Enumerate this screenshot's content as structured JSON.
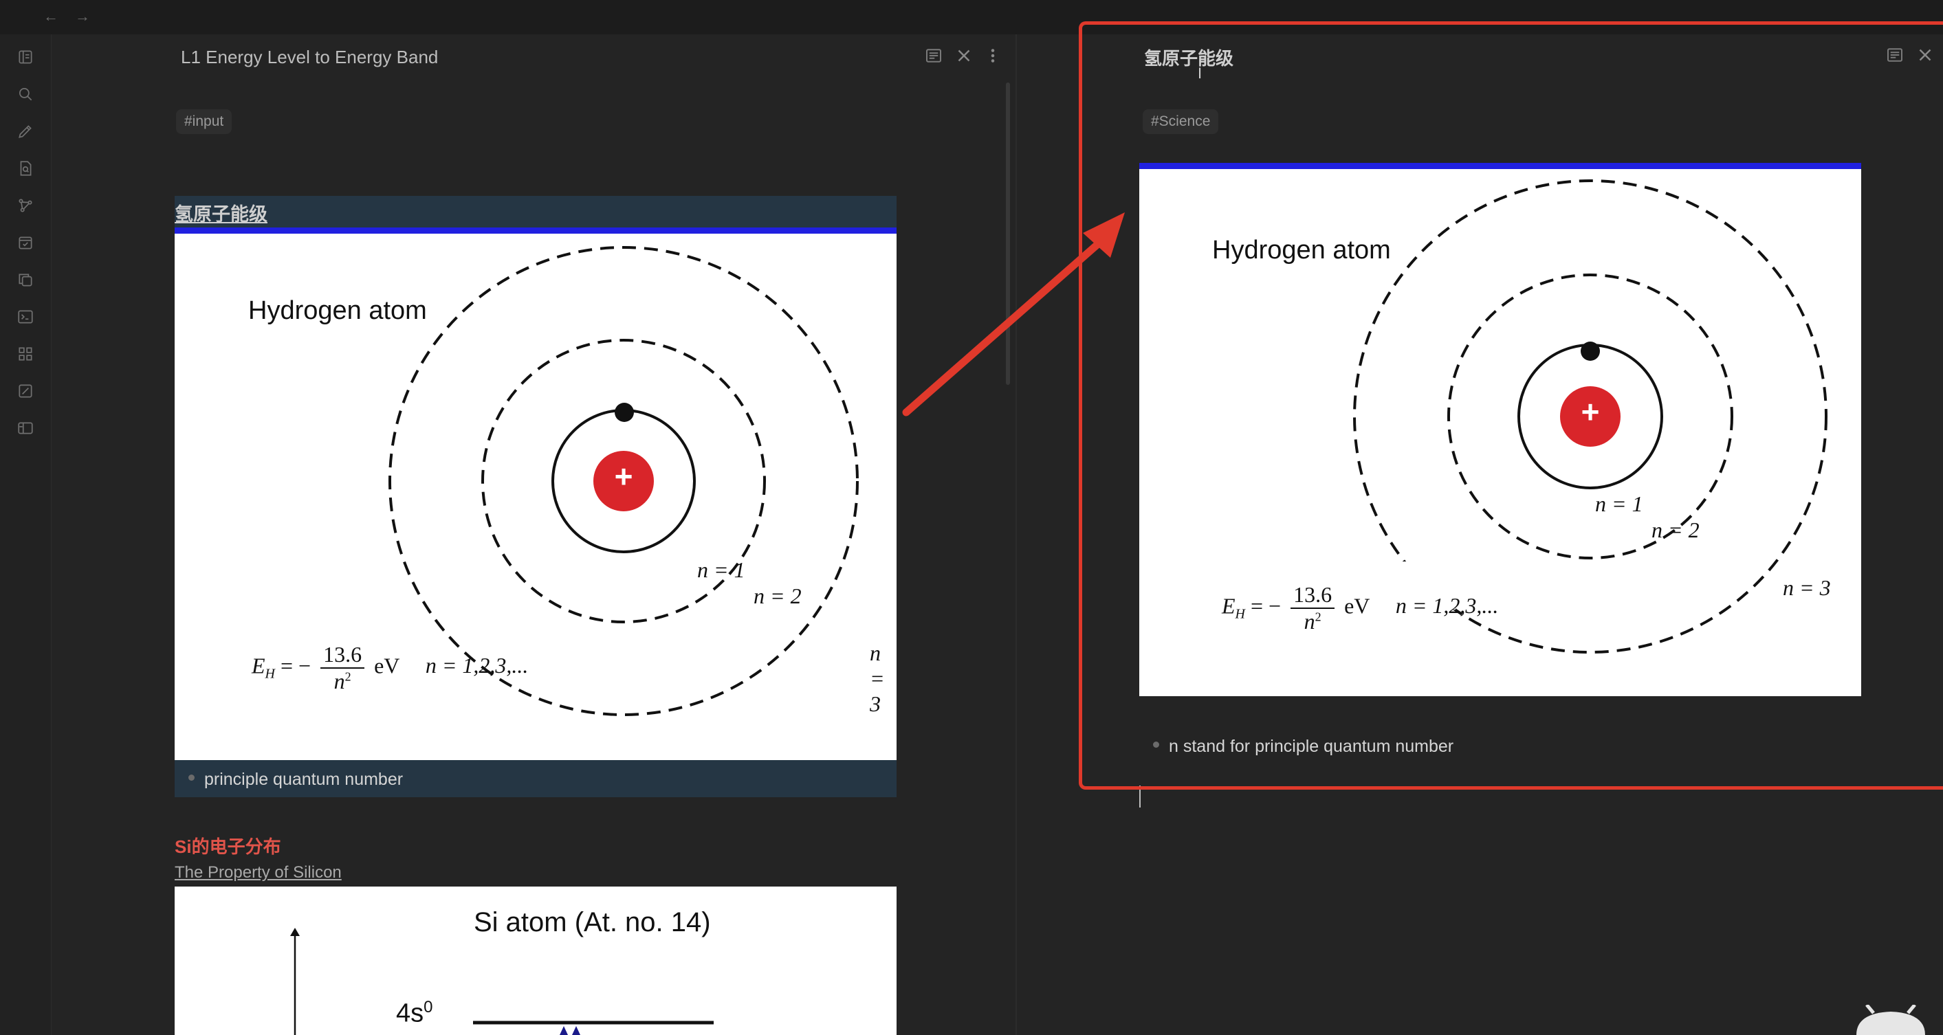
{
  "left_pane": {
    "title": "L1 Energy Level to Energy Band",
    "tag": "#input",
    "heading": "氢原子能级",
    "figure": {
      "title": "Hydrogen atom",
      "nucleus_symbol": "+",
      "orbit_labels": [
        "n = 1",
        "n = 2",
        "n = 3"
      ],
      "formula_lhs": "E",
      "formula_sub": "H",
      "formula_eq": "= −",
      "formula_num": "13.6",
      "formula_den": "n",
      "formula_den_sup": "2",
      "formula_unit": "eV",
      "formula_n": "n = 1,2,3,..."
    },
    "bullet": "principle quantum number",
    "section2_title": "Si的电子分布",
    "section2_link": "The Property of Silicon",
    "figure2": {
      "title": "Si atom (At. no. 14)",
      "level_label": "4s",
      "level_sup": "0"
    }
  },
  "right_pane": {
    "title": "氢原子能级",
    "tag": "#Science",
    "figure": {
      "title": "Hydrogen atom",
      "nucleus_symbol": "+",
      "orbit_labels": [
        "n = 1",
        "n = 2",
        "n = 3"
      ],
      "formula_lhs": "E",
      "formula_sub": "H",
      "formula_eq": "= −",
      "formula_num": "13.6",
      "formula_den": "n",
      "formula_den_sup": "2",
      "formula_unit": "eV",
      "formula_n": "n = 1,2,3,..."
    },
    "bullet": "n stand for principle quantum number"
  },
  "ribbon_icons": [
    "file-explorer-icon",
    "search-icon",
    "pen-icon",
    "file-search-icon",
    "graph-icon",
    "calendar-check-icon",
    "copy-icon",
    "terminal-icon",
    "apps-icon",
    "canvas-icon",
    "layout-icon"
  ],
  "colors": {
    "accent_frame": "#e0392b",
    "arrow": "#e0392b",
    "heading_highlight": "#253644",
    "figure_blue_bar": "#2020e0",
    "nucleus": "#d9252a"
  }
}
